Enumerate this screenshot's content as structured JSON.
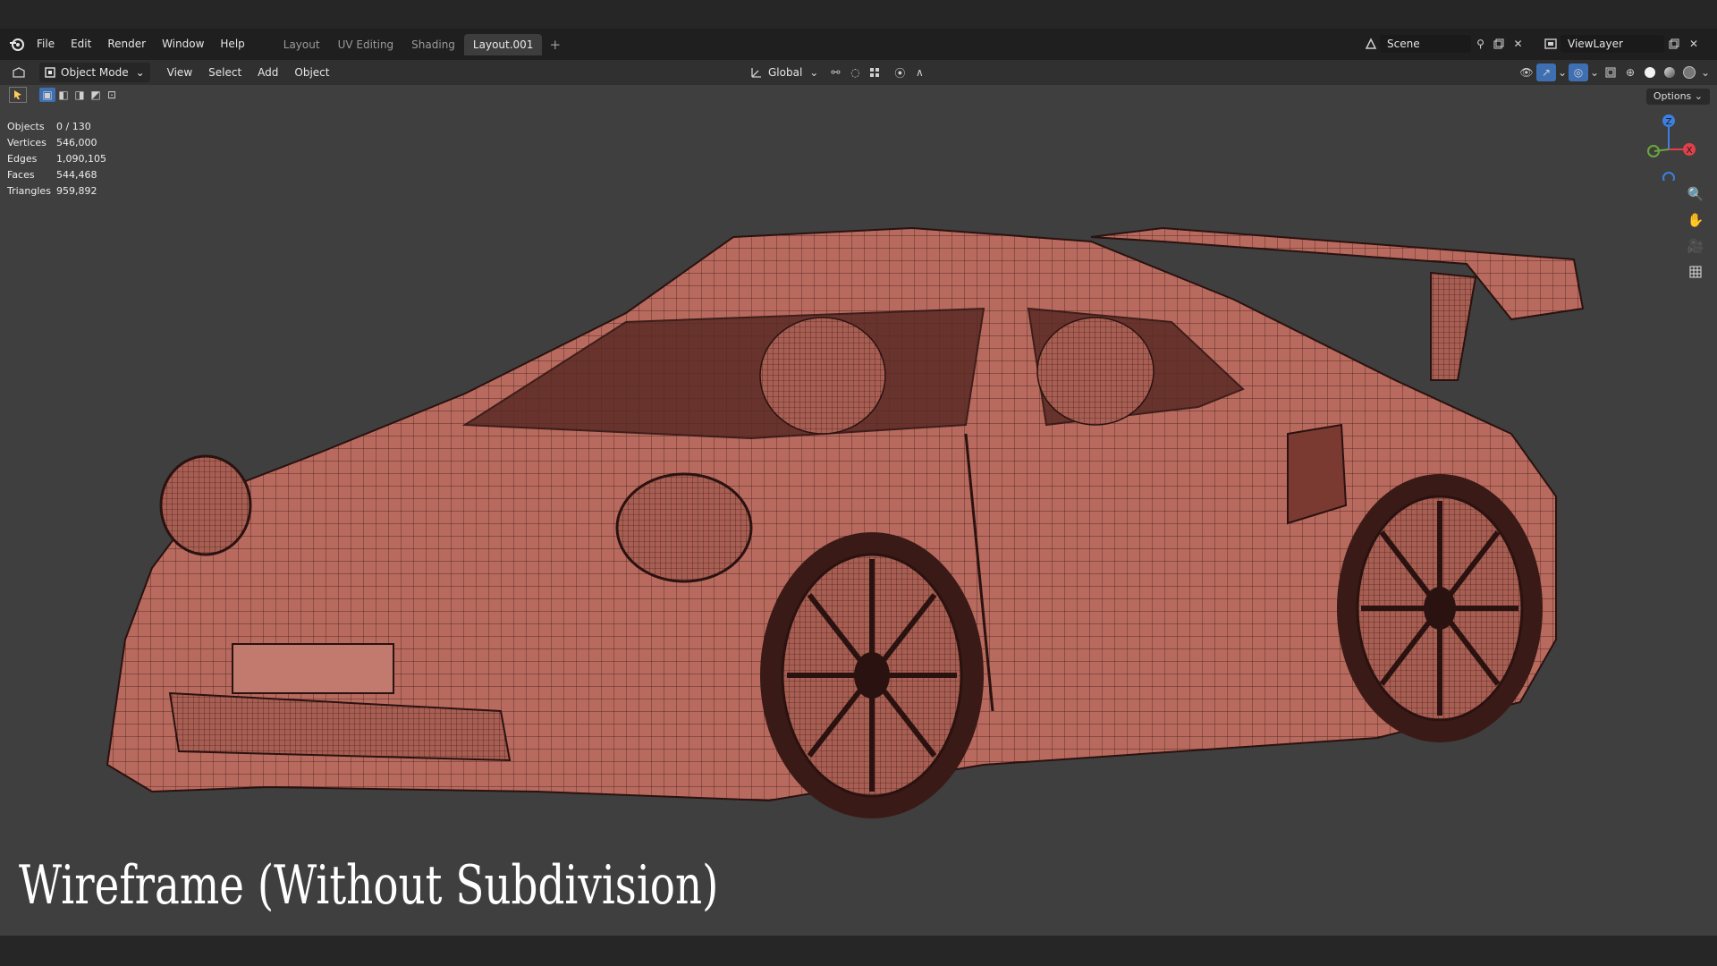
{
  "menu": [
    "File",
    "Edit",
    "Render",
    "Window",
    "Help"
  ],
  "workspace_tabs": [
    {
      "label": "Layout",
      "active": false
    },
    {
      "label": "UV Editing",
      "active": false
    },
    {
      "label": "Shading",
      "active": false
    },
    {
      "label": "Layout.001",
      "active": true
    }
  ],
  "add_tab": "+",
  "scene_label": "Scene",
  "view_layer_label": "ViewLayer",
  "header": {
    "mode": "Object Mode",
    "menus": [
      "View",
      "Select",
      "Add",
      "Object"
    ],
    "transform_orientation": "Global"
  },
  "options_label": "Options",
  "stats": [
    {
      "key": "Objects",
      "value": "0 / 130"
    },
    {
      "key": "Vertices",
      "value": "546,000"
    },
    {
      "key": "Edges",
      "value": "1,090,105"
    },
    {
      "key": "Faces",
      "value": "544,468"
    },
    {
      "key": "Triangles",
      "value": "959,892"
    }
  ],
  "gizmo_axes": {
    "z": "Z",
    "x": "X"
  },
  "caption": "Wireframe (Without Subdivision)",
  "colors": {
    "car": "#b86a5e",
    "wire": "#2a1210",
    "viewport": "#3f3f3f",
    "axis_x": "#e0404a",
    "axis_y": "#6aa83a",
    "axis_z": "#3c7fe0"
  }
}
